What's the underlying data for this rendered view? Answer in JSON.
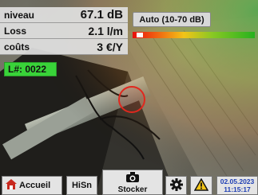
{
  "readings": {
    "level": {
      "label": "niveau",
      "value": "67.1 dB"
    },
    "loss": {
      "label": "Loss",
      "value": "2.1 l/m"
    },
    "cost": {
      "label": "coûts",
      "value": "3 €/Y"
    }
  },
  "leak_id": "L#: 0022",
  "range_button": "Auto (10-70 dB)",
  "level_fraction": 0.02,
  "colors": {
    "accent_green": "#39d339",
    "marker_red": "#e0281e",
    "date_blue": "#1f3fb4"
  },
  "toolbar": {
    "home_label": "Accueil",
    "history_label": "HiSn",
    "store_label": "Stocker",
    "date": "02.05.2023",
    "time": "11:15:17"
  },
  "icons": {
    "home": "home-icon",
    "camera": "camera-icon",
    "settings": "gear-icon",
    "warning": "warning-icon"
  }
}
